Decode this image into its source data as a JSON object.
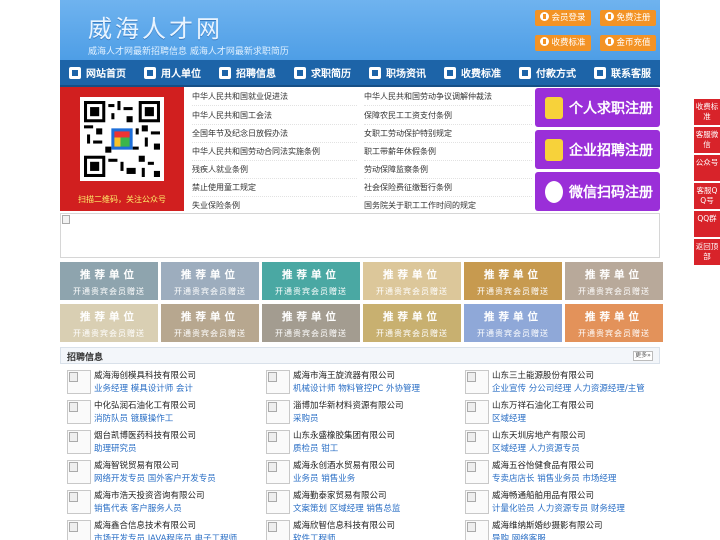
{
  "header": {
    "title": "威海人才网",
    "subtitle": "威海人才网最新招聘信息   威海人才网最新求职简历",
    "buttons": [
      "会员登录",
      "免费注册",
      "收费标准",
      "金币充值"
    ]
  },
  "nav": {
    "items": [
      {
        "label": "网站首页",
        "icon": "home-icon"
      },
      {
        "label": "用人单位",
        "icon": "building-icon"
      },
      {
        "label": "招聘信息",
        "icon": "megaphone-icon"
      },
      {
        "label": "求职简历",
        "icon": "resume-icon"
      },
      {
        "label": "职场资讯",
        "icon": "news-icon"
      },
      {
        "label": "收费标准",
        "icon": "coin-icon"
      },
      {
        "label": "付款方式",
        "icon": "card-icon"
      },
      {
        "label": "联系客服",
        "icon": "phone-icon"
      }
    ]
  },
  "qr": {
    "caption": "扫描二维码，关注公众号"
  },
  "laws": {
    "left": [
      "中华人民共和国就业促进法",
      "中华人民共和国工会法",
      "全国年节及纪念日放假办法",
      "中华人民共和国劳动合同法实施条例",
      "残疾人就业条例",
      "禁止使用童工规定",
      "失业保险条例"
    ],
    "right": [
      "中华人民共和国劳动争议调解仲裁法",
      "保障农民工工资支付条例",
      "女职工劳动保护特别规定",
      "职工带薪年休假条例",
      "劳动保障监察条例",
      "社会保险费征缴暂行条例",
      "国务院关于职工工作时间的规定"
    ]
  },
  "register": [
    "个人求职注册",
    "企业招聘注册",
    "微信扫码注册"
  ],
  "recommend": {
    "title": "推荐单位",
    "sub": "开通贵宾会员赠送",
    "colors": [
      "#8ea4ae",
      "#9dadbe",
      "#4aa8a3",
      "#dcc79a",
      "#c79a4f",
      "#b8a99a",
      "#d9cfb3",
      "#b7a78f",
      "#a39c90",
      "#c8b070",
      "#8fa8d8",
      "#e3925a",
      "#9ba9b7"
    ]
  },
  "jobs": {
    "title": "招聘信息",
    "more": "更多»",
    "columns": [
      [
        {
          "company": "威海海创模具科技有限公司",
          "positions": "业务经理 模具设计师 会计"
        },
        {
          "company": "中化弘润石油化工有限公司",
          "positions": "消防队员 镀膜操作工"
        },
        {
          "company": "烟台凯博医药科技有限公司",
          "positions": "助理研究员"
        },
        {
          "company": "威海智锐贸易有限公司",
          "positions": "网络开发专员 国外客户开发专员"
        },
        {
          "company": "威海市浩天投资咨询有限公司",
          "positions": "销售代表 客户服务人员"
        },
        {
          "company": "威海鑫合信息技术有限公司",
          "positions": "市场开发专员 JAVA程序员 电子工程师"
        }
      ],
      [
        {
          "company": "威海市海王旋流器有限公司",
          "positions": "机械设计师 物料管控PC 外协管理"
        },
        {
          "company": "淄博加华新材料资源有限公司",
          "positions": "采购员"
        },
        {
          "company": "山东永盛橡胶集团有限公司",
          "positions": "质检员 钳工"
        },
        {
          "company": "威海永创酒水贸易有限公司",
          "positions": "业务员 销售业务"
        },
        {
          "company": "威海勤泰家贸易有限公司",
          "positions": "文案策划 区域经理 销售总监"
        },
        {
          "company": "威海欣智信息科技有限公司",
          "positions": "软件工程师"
        }
      ],
      [
        {
          "company": "山东三土能源股份有限公司",
          "positions": "企业宣传 分公司经理 人力资源经理/主管"
        },
        {
          "company": "山东万祥石油化工有限公司",
          "positions": "区域经理"
        },
        {
          "company": "山东天圳房地产有限公司",
          "positions": "区域经理 人力资源专员"
        },
        {
          "company": "威海五谷怡健食品有限公司",
          "positions": "专卖店店长 销售业务员 市场经理"
        },
        {
          "company": "威海畅通船舶用品有限公司",
          "positions": "计量化验员 人力资源专员 财务经理"
        },
        {
          "company": "威海维纳斯婚纱摄影有限公司",
          "positions": "导购 网络客服"
        }
      ]
    ]
  },
  "side": [
    "收费标准",
    "客服微信",
    "公众号",
    "客服QQ号",
    "QQ群",
    "返回顶部"
  ]
}
